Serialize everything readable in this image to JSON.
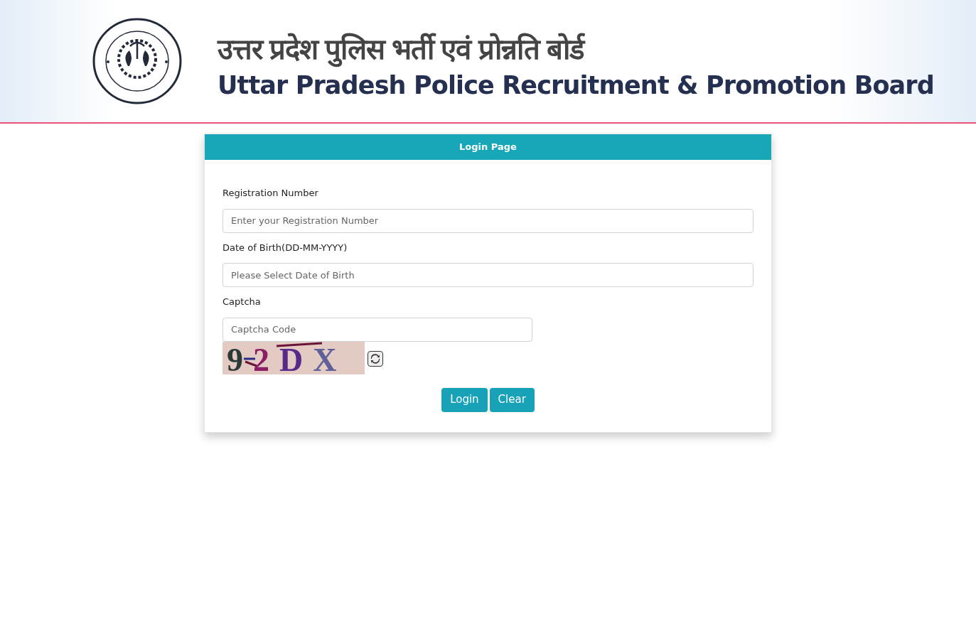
{
  "header": {
    "title_hindi": "उत्तर प्रदेश पुलिस भर्ती एवं प्रोन्नति बोर्ड",
    "title_english": "Uttar Pradesh Police Recruitment & Promotion Board"
  },
  "card": {
    "title": "Login Page",
    "fields": [
      {
        "label": "Registration Number",
        "placeholder": "Enter your Registration Number"
      },
      {
        "label": "Date of Birth(DD-MM-YYYY)",
        "placeholder": "Please Select Date of Birth"
      },
      {
        "label": "Captcha",
        "placeholder": "Captcha Code"
      }
    ],
    "captcha": [
      {
        "char": "9",
        "color": "#2b3a36"
      },
      {
        "char": "2",
        "color": "#8a1f63"
      },
      {
        "char": "D",
        "color": "#5a2a8a"
      },
      {
        "char": "X",
        "color": "#5f5f9a"
      }
    ],
    "buttons": [
      "Login",
      "Clear"
    ]
  }
}
